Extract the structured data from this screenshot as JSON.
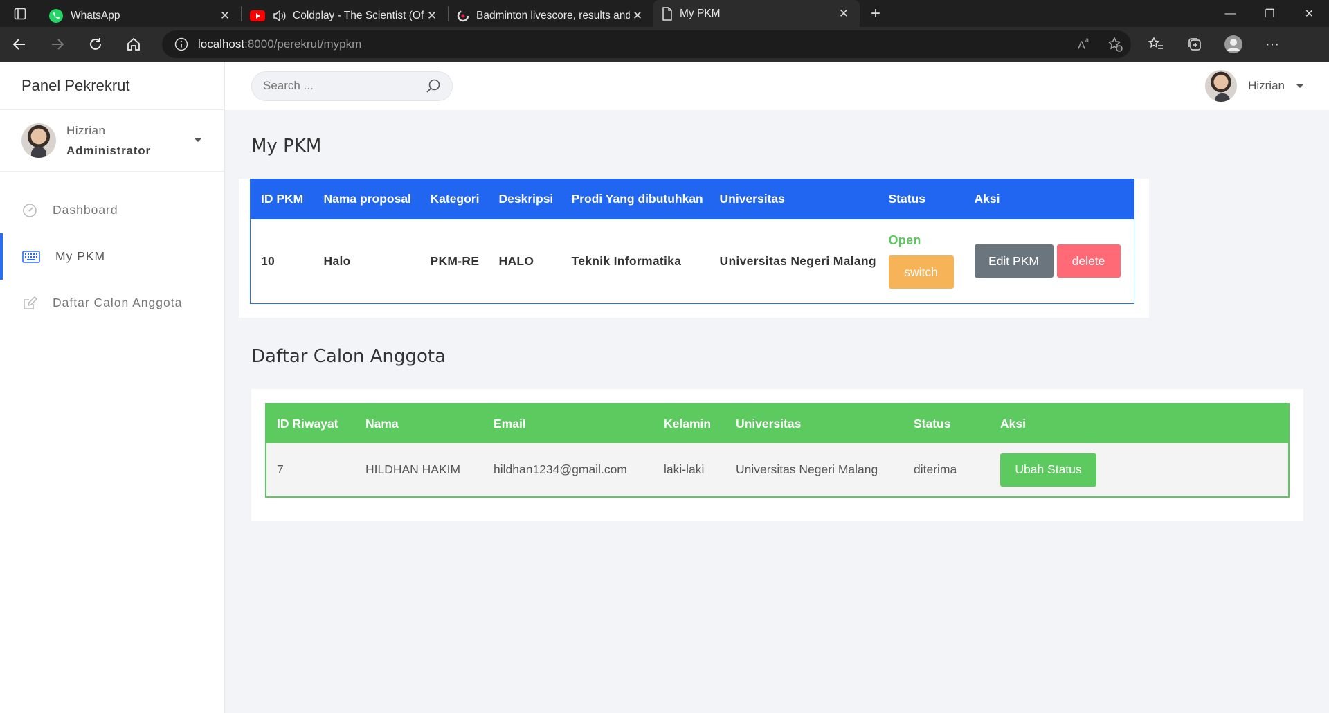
{
  "browser": {
    "tabs": [
      {
        "title": "WhatsApp",
        "icon": "whatsapp-icon",
        "active": false
      },
      {
        "title": "Coldplay - The Scientist (Offi",
        "icon": "youtube-icon",
        "active": false
      },
      {
        "title": "Badminton livescore, results and",
        "icon": "flashscore-icon",
        "active": false
      },
      {
        "title": "My PKM",
        "icon": "page-icon",
        "active": true
      }
    ],
    "url_host": "localhost",
    "url_path": ":8000/perekrut/mypkm"
  },
  "sidebar": {
    "brand": "Panel Pekrekrut",
    "user_name": "Hizrian",
    "user_role": "Administrator",
    "items": [
      {
        "label": "Dashboard",
        "icon": "dashboard-icon"
      },
      {
        "label": "My PKM",
        "icon": "keyboard-icon"
      },
      {
        "label": "Daftar Calon Anggota",
        "icon": "edit-icon"
      }
    ]
  },
  "topbar": {
    "search_placeholder": "Search ...",
    "user_name": "Hizrian"
  },
  "pkm": {
    "title": "My PKM",
    "headers": [
      "ID PKM",
      "Nama proposal",
      "Kategori",
      "Deskripsi",
      "Prodi Yang dibutuhkan",
      "Universitas",
      "Status",
      "Aksi"
    ],
    "row": {
      "id": "10",
      "nama": "Halo",
      "kategori": "PKM-RE",
      "deskripsi": "HALO",
      "prodi": "Teknik Informatika",
      "universitas": "Universitas Negeri Malang",
      "status": "Open",
      "switch_label": "switch",
      "edit_label": "Edit PKM",
      "delete_label": "delete"
    }
  },
  "anggota": {
    "title": "Daftar Calon Anggota",
    "headers": [
      "ID Riwayat",
      "Nama",
      "Email",
      "Kelamin",
      "Universitas",
      "Status",
      "Aksi"
    ],
    "row": {
      "id": "7",
      "nama": "HILDHAN HAKIM",
      "email": "hildhan1234@gmail.com",
      "kelamin": "laki-laki",
      "universitas": "Universitas Negeri Malang",
      "status": "diterima",
      "action_label": "Ubah Status"
    }
  },
  "colors": {
    "primary": "#2166f0",
    "success": "#5dca5f",
    "warning": "#f7b357",
    "danger": "#ff6a76",
    "secondary": "#6b757d"
  }
}
